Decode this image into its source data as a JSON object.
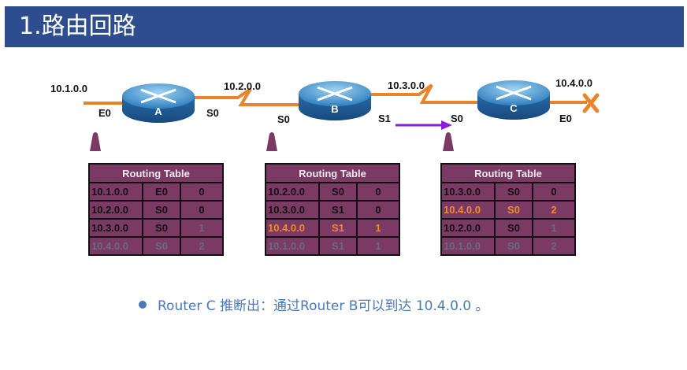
{
  "title": "1.路由回路",
  "networks": {
    "net_a": "10.1.0.0",
    "net_ab": "10.2.0.0",
    "net_bc": "10.3.0.0",
    "net_c": "10.4.0.0"
  },
  "routers": [
    {
      "name": "A",
      "left_if": "E0",
      "right_if": "S0"
    },
    {
      "name": "B",
      "left_if": "S0",
      "right_if": "S1"
    },
    {
      "name": "C",
      "left_if": "S0",
      "right_if": "E0"
    }
  ],
  "failure_mark": "X",
  "tables": [
    {
      "header": "Routing Table",
      "rows": [
        {
          "net": "10.1.0.0",
          "iface": "E0",
          "hops": "0",
          "style": "normal"
        },
        {
          "net": "10.2.0.0",
          "iface": "S0",
          "hops": "0",
          "style": "normal"
        },
        {
          "net": "10.3.0.0",
          "iface": "S0",
          "hops": "1",
          "style": "mixed"
        },
        {
          "net": "10.4.0.0",
          "iface": "S0",
          "hops": "2",
          "style": "learned"
        }
      ]
    },
    {
      "header": "Routing Table",
      "rows": [
        {
          "net": "10.2.0.0",
          "iface": "S0",
          "hops": "0",
          "style": "normal"
        },
        {
          "net": "10.3.0.0",
          "iface": "S1",
          "hops": "0",
          "style": "normal"
        },
        {
          "net": "10.4.0.0",
          "iface": "S1",
          "hops": "1",
          "style": "hl"
        },
        {
          "net": "10.1.0.0",
          "iface": "S1",
          "hops": "1",
          "style": "learned"
        }
      ]
    },
    {
      "header": "Routing Table",
      "rows": [
        {
          "net": "10.3.0.0",
          "iface": "S0",
          "hops": "0",
          "style": "normal"
        },
        {
          "net": "10.4.0.0",
          "iface": "S0",
          "hops": "2",
          "style": "hl"
        },
        {
          "net": "10.2.0.0",
          "iface": "S0",
          "hops": "1",
          "style": "mixed"
        },
        {
          "net": "10.1.0.0",
          "iface": "S0",
          "hops": "2",
          "style": "learned"
        }
      ]
    }
  ],
  "bullet": "Router C 推断出：通过Router B可以到达 10.4.0.0 。",
  "colors": {
    "title_bg": "#2e4d8f",
    "link": "#e8852a",
    "table_cell": "#7a3a63",
    "highlight": "#f08a2a",
    "arrow": "#8a1ed6",
    "bullet_text": "#4a7ab5"
  },
  "icons": [
    "router-icon",
    "failure-x-icon",
    "update-arrow-icon",
    "pointer-triangle-icon"
  ]
}
